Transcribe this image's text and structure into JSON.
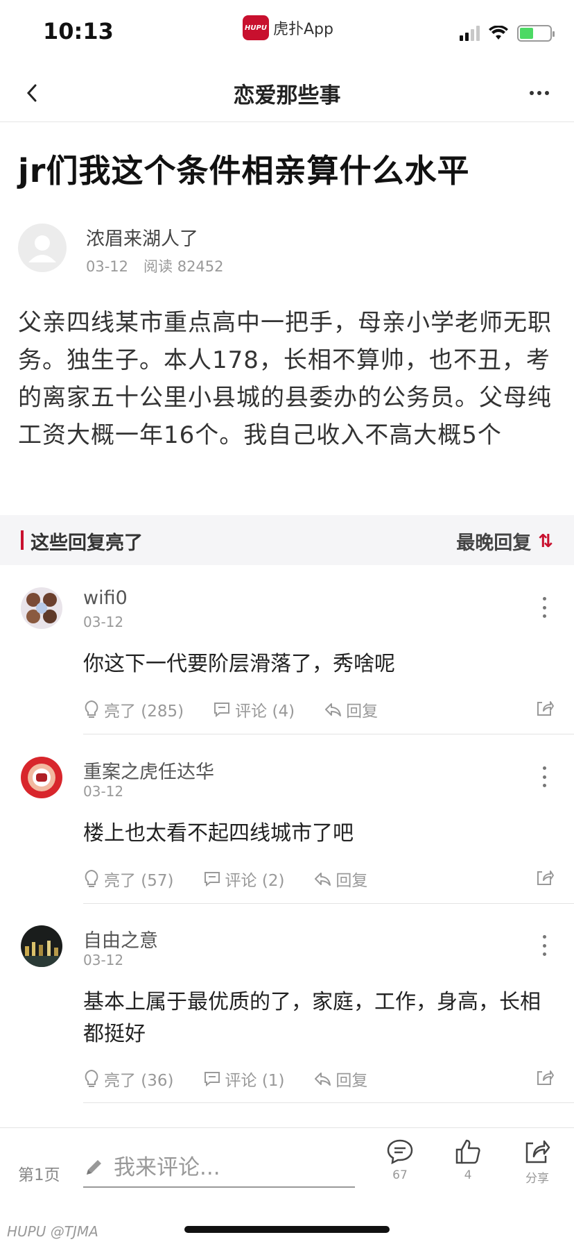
{
  "status_bar": {
    "time": "10:13",
    "app_logo_text": "HUPU",
    "app_name": "虎扑App",
    "battery_color": "#4cd964"
  },
  "nav": {
    "title": "恋爱那些事",
    "back_icon": "chevron-left-icon",
    "more_icon": "more-icon"
  },
  "post": {
    "title": "jr们我这个条件相亲算什么水平",
    "author": "浓眉来湖人了",
    "date": "03-12",
    "reads": "阅读 82452",
    "body": "父亲四线某市重点高中一把手，母亲小学老师无职务。独生子。本人178，长相不算帅，也不丑，考的离家五十公里小县城的县委办的公务员。父母纯工资大概一年16个。我自己收入不高大概5个"
  },
  "replies_section": {
    "title": "这些回复亮了",
    "sort_label": "最晚回复",
    "sort_icon": "sort-arrows-icon",
    "accent": "#c8102e"
  },
  "replies": [
    {
      "name": "wifi0",
      "date": "03-12",
      "text": "你这下一代要阶层滑落了，秀啥呢",
      "light": "亮了 (285)",
      "comment": "评论 (4)",
      "reply": "回复"
    },
    {
      "name": "重案之虎任达华",
      "date": "03-12",
      "text": "楼上也太看不起四线城市了吧",
      "light": "亮了 (57)",
      "comment": "评论 (2)",
      "reply": "回复"
    },
    {
      "name": "自由之意",
      "date": "03-12",
      "text": "基本上属于最优质的了，家庭，工作，身高，长相都挺好",
      "light": "亮了 (36)",
      "comment": "评论 (1)",
      "reply": "回复"
    }
  ],
  "bottom_bar": {
    "page": "第1页",
    "comment_placeholder": "我来评论...",
    "comments_count": "67",
    "likes_count": "4",
    "share_label": "分享"
  },
  "watermark": "HUPU @TJMA"
}
